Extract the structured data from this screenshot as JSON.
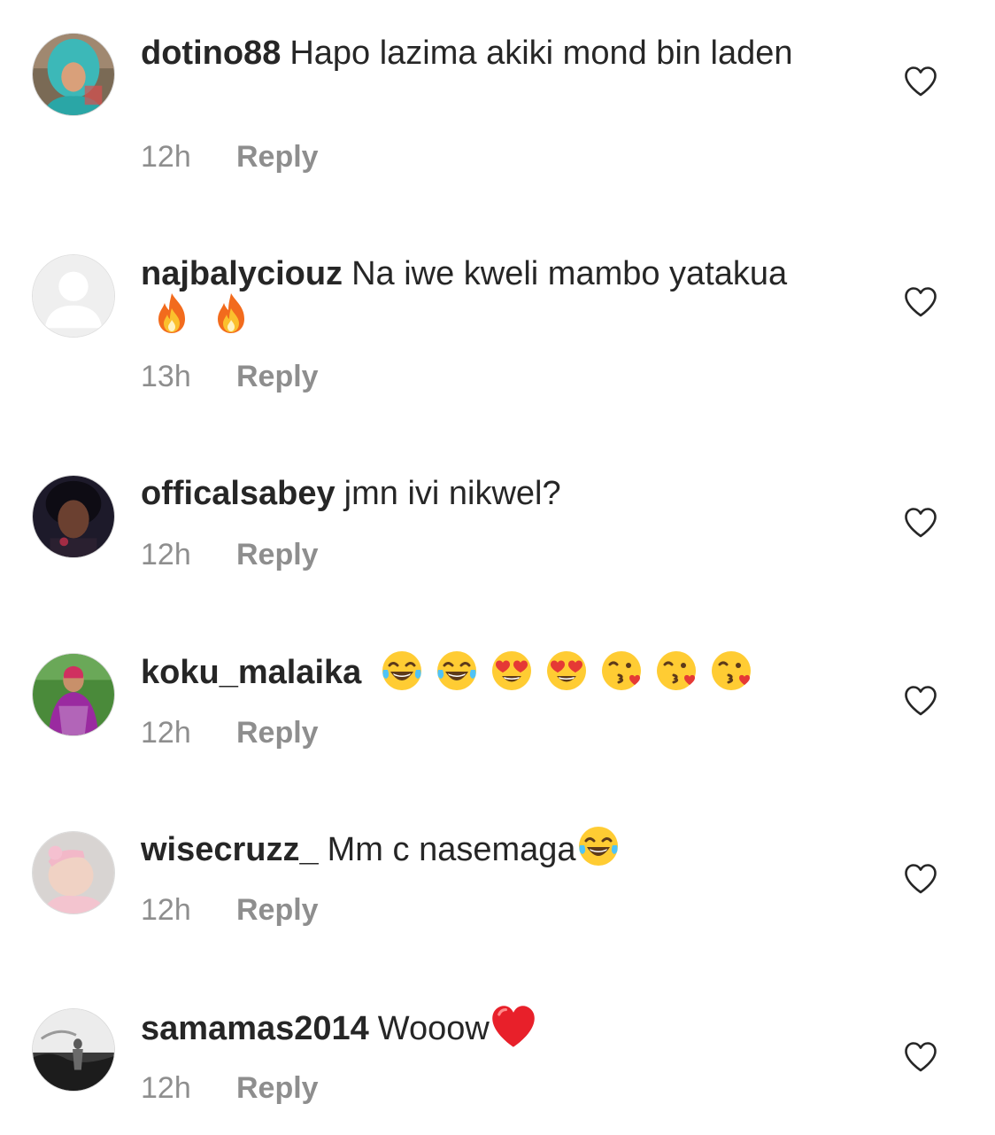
{
  "comments": [
    {
      "username": "dotino88",
      "text": "Hapo lazima akiki mond bin laden",
      "time": "12h",
      "reply_label": "Reply",
      "avatar": "avatar-photo-teal-hijab",
      "like_icon": "heart-outline-icon"
    },
    {
      "username": "najbalyciouz",
      "text": "Na iwe kweli mambo yatakua",
      "emojis": [
        "fire-emoji",
        "fire-emoji"
      ],
      "time": "13h",
      "reply_label": "Reply",
      "avatar": "default-avatar-placeholder",
      "like_icon": "heart-outline-icon"
    },
    {
      "username": "officalsabey",
      "text": "jmn ivi nikwel?",
      "time": "12h",
      "reply_label": "Reply",
      "avatar": "avatar-photo-dark",
      "like_icon": "heart-outline-icon"
    },
    {
      "username": "koku_malaika",
      "text": "",
      "emojis": [
        "tears-of-joy-emoji",
        "tears-of-joy-emoji",
        "heart-eyes-emoji",
        "heart-eyes-emoji",
        "kissing-heart-emoji",
        "kissing-heart-emoji",
        "kissing-heart-emoji"
      ],
      "time": "12h",
      "reply_label": "Reply",
      "avatar": "avatar-photo-green-purple",
      "like_icon": "heart-outline-icon"
    },
    {
      "username": "wisecruzz_",
      "text": "Mm c nasemaga",
      "emojis": [
        "tears-of-joy-emoji"
      ],
      "time": "12h",
      "reply_label": "Reply",
      "avatar": "avatar-photo-baby-pink",
      "like_icon": "heart-outline-icon"
    },
    {
      "username": "samamas2014",
      "text": "Wooow",
      "emojis": [
        "red-heart-emoji"
      ],
      "time": "12h",
      "reply_label": "Reply",
      "avatar": "avatar-photo-grayscale",
      "like_icon": "heart-outline-icon"
    }
  ],
  "colors": {
    "text": "#262626",
    "meta": "#8e8e8e",
    "border": "#dbdbdb"
  }
}
